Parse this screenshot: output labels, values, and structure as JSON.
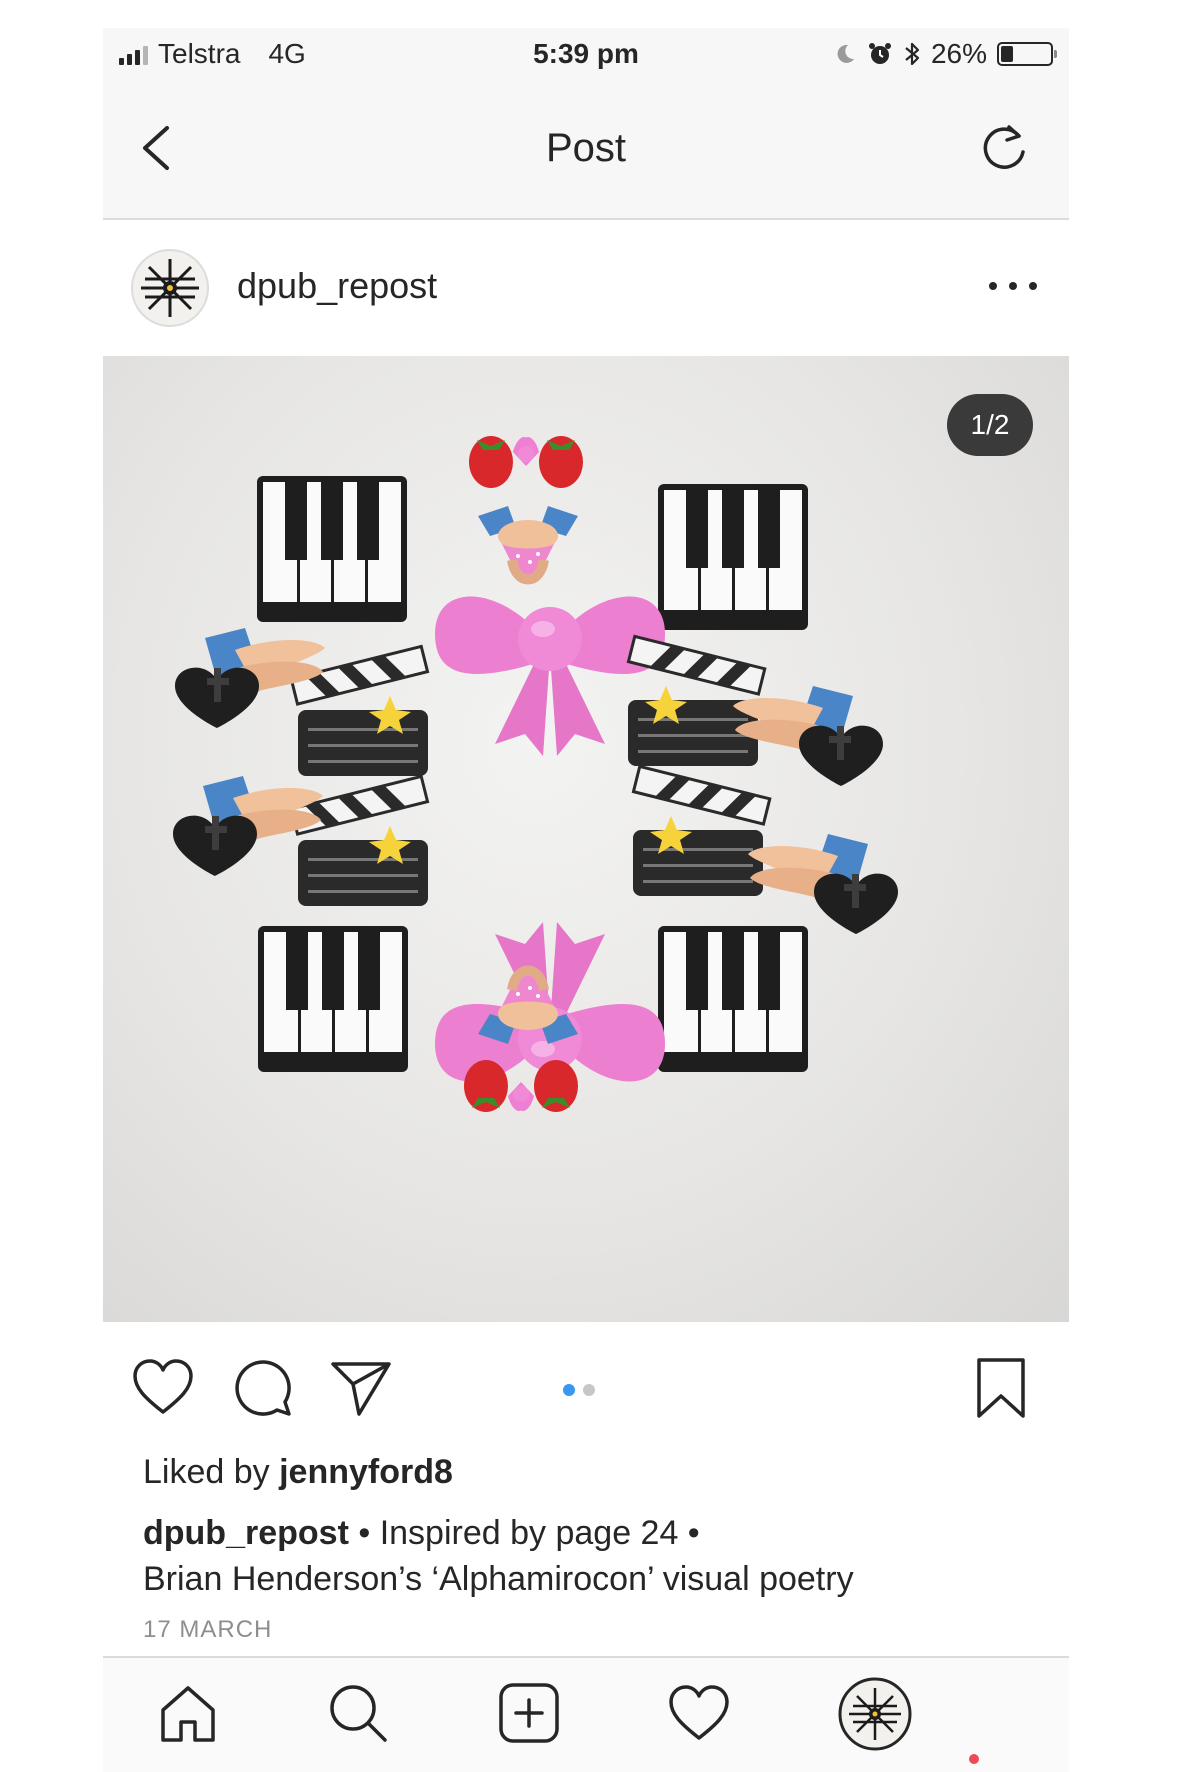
{
  "status_bar": {
    "carrier": "Telstra",
    "network": "4G",
    "time": "5:39 pm",
    "battery": "26%",
    "battery_level": 0.26,
    "icons": [
      "signal-icon",
      "moon-icon",
      "alarm-icon",
      "bluetooth-icon",
      "battery-icon"
    ]
  },
  "header": {
    "title": "Post",
    "back_icon": "chevron-left-icon",
    "refresh_icon": "refresh-icon"
  },
  "post": {
    "username": "dpub_repost",
    "more_icon": "more-horizontal-icon",
    "image_counter": "1/2",
    "carousel": {
      "total": 2,
      "active": 1
    },
    "liked_by_prefix": "Liked by",
    "liked_by_user": "jennyford8",
    "caption_username": "dpub_repost",
    "caption_line1": " • Inspired by page 24 •",
    "caption_line2": "Brian Henderson’s ‘Alphamirocon’ visual poetry",
    "date": "17 MARCH"
  },
  "colors": {
    "accent_blue": "#3897f0",
    "dot_inactive": "#c7c7c7",
    "notification_red": "#ed4956",
    "text": "#262626",
    "muted": "#8e8e8e"
  },
  "tabbar": [
    "home-icon",
    "search-icon",
    "add-post-icon",
    "activity-heart-icon",
    "profile-avatar"
  ]
}
